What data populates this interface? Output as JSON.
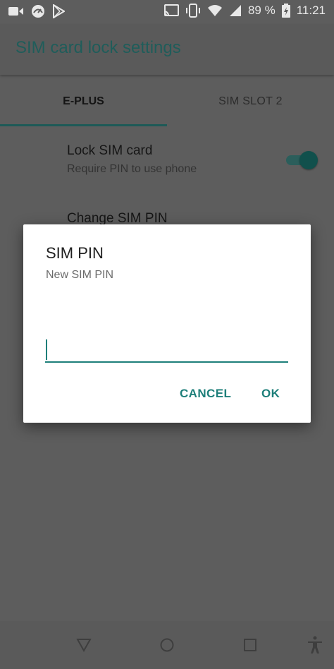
{
  "status_bar": {
    "battery_percent": "89 %",
    "time": "11:21",
    "left_icons": [
      "video-camera-icon",
      "speedometer-icon",
      "play-store-icon"
    ],
    "right_icons": [
      "cast-icon",
      "vibrate-icon",
      "wifi-icon",
      "signal-icon",
      "battery-charging-icon"
    ]
  },
  "app_bar": {
    "title": "SIM card lock settings"
  },
  "tabs": [
    {
      "label": "E-PLUS",
      "selected": true
    },
    {
      "label": "SIM SLOT 2",
      "selected": false
    }
  ],
  "settings": {
    "lock_sim": {
      "title": "Lock SIM card",
      "summary": "Require PIN to use phone",
      "enabled": true
    },
    "change_pin": {
      "title": "Change SIM PIN"
    }
  },
  "dialog": {
    "title": "SIM PIN",
    "message": "New SIM PIN",
    "input_value": "",
    "cancel_label": "CANCEL",
    "ok_label": "OK"
  },
  "nav_bar": {
    "icons": [
      "back-icon",
      "home-icon",
      "recents-icon",
      "accessibility-icon"
    ]
  },
  "colors": {
    "accent": "#1e7f7a",
    "scrim_background": "#5d5d5d"
  }
}
